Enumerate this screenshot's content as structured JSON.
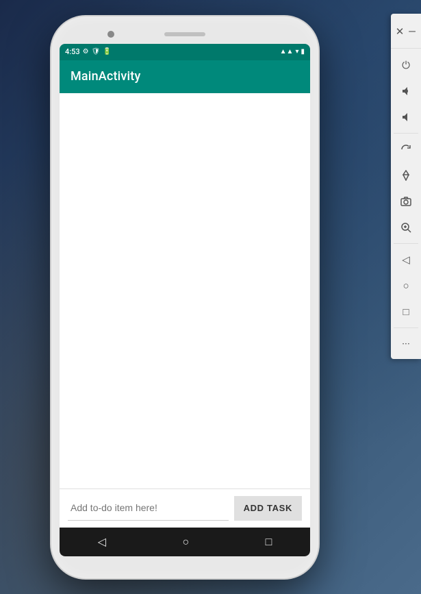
{
  "phone": {
    "status_bar": {
      "time": "4:53",
      "signal_icon": "▲",
      "wifi_icon": "▾",
      "battery_icon": "▮"
    },
    "app_bar": {
      "title": "MainActivity"
    },
    "content": {
      "empty_text": ""
    },
    "input": {
      "placeholder": "Add to-do item here!",
      "add_button_label": "ADD TASK"
    },
    "nav_bar": {
      "back_icon": "◁",
      "home_icon": "○",
      "recents_icon": "□"
    }
  },
  "toolbar": {
    "close_label": "✕",
    "minimize_label": "—",
    "icons": [
      {
        "name": "power-icon",
        "symbol": "⏻"
      },
      {
        "name": "volume-up-icon",
        "symbol": "🔊"
      },
      {
        "name": "volume-down-icon",
        "symbol": "🔉"
      },
      {
        "name": "rotate-icon",
        "symbol": "⟳"
      },
      {
        "name": "location-icon",
        "symbol": "◇"
      },
      {
        "name": "camera-icon",
        "symbol": "⊙"
      },
      {
        "name": "zoom-icon",
        "symbol": "⊕"
      },
      {
        "name": "back-icon",
        "symbol": "◁"
      },
      {
        "name": "home-circle-icon",
        "symbol": "○"
      },
      {
        "name": "square-icon",
        "symbol": "□"
      },
      {
        "name": "more-icon",
        "symbol": "···"
      }
    ]
  },
  "colors": {
    "app_bar_bg": "#00897b",
    "status_bar_bg": "#00796b",
    "nav_bar_bg": "#1a1a1a",
    "button_bg": "#e0e0e0"
  }
}
